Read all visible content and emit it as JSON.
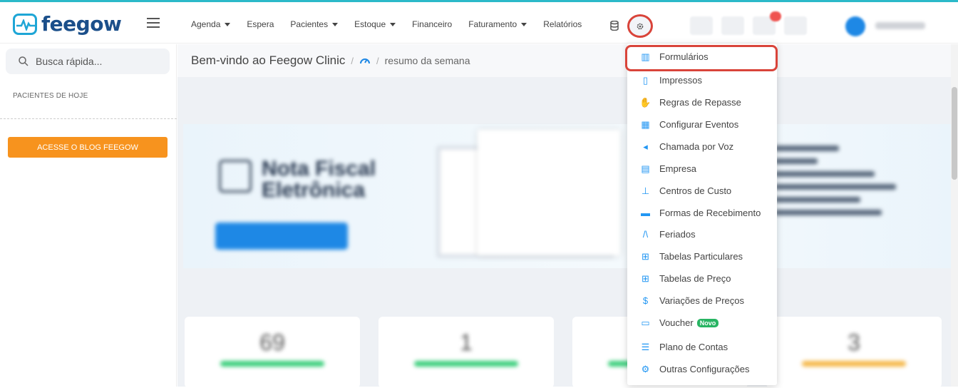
{
  "app": {
    "logo_text": "feegow"
  },
  "nav": {
    "items": [
      {
        "label": "Agenda",
        "dropdown": true
      },
      {
        "label": "Espera",
        "dropdown": false
      },
      {
        "label": "Pacientes",
        "dropdown": true
      },
      {
        "label": "Estoque",
        "dropdown": true
      },
      {
        "label": "Financeiro",
        "dropdown": false
      },
      {
        "label": "Faturamento",
        "dropdown": true
      },
      {
        "label": "Relatórios",
        "dropdown": false
      }
    ]
  },
  "sidebar": {
    "search_placeholder": "Busca rápida...",
    "patients_today": "PACIENTES DE HOJE",
    "blog_button": "ACESSE O BLOG FEEGOW"
  },
  "breadcrumb": {
    "title": "Bem-vindo ao Feegow Clinic",
    "sub": "resumo da semana"
  },
  "banner": {
    "title_line1": "Nota Fiscal",
    "title_line2": "Eletrônica"
  },
  "cards": [
    {
      "value": "69",
      "color": "#3ccf7c"
    },
    {
      "value": "1",
      "color": "#3ccf7c"
    },
    {
      "value": "",
      "color": "#3ccf7c"
    },
    {
      "value": "3",
      "color": "#f5b84a"
    }
  ],
  "settings_menu": {
    "items": [
      {
        "label": "Formulários",
        "icon": "chart-icon"
      },
      {
        "label": "Impressos",
        "icon": "file-icon"
      },
      {
        "label": "Regras de Repasse",
        "icon": "handshake-icon"
      },
      {
        "label": "Configurar Eventos",
        "icon": "calendar-icon"
      },
      {
        "label": "Chamada por Voz",
        "icon": "speaker-icon"
      },
      {
        "label": "Empresa",
        "icon": "building-icon"
      },
      {
        "label": "Centros de Custo",
        "icon": "sitemap-icon"
      },
      {
        "label": "Formas de Recebimento",
        "icon": "credit-card-icon"
      },
      {
        "label": "Feriados",
        "icon": "road-icon"
      },
      {
        "label": "Tabelas Particulares",
        "icon": "table-icon"
      },
      {
        "label": "Tabelas de Preço",
        "icon": "table-icon"
      },
      {
        "label": "Variações de Preços",
        "icon": "dollar-icon"
      },
      {
        "label": "Voucher",
        "icon": "ticket-icon",
        "badge": "Novo"
      },
      {
        "label": "Plano de Contas",
        "icon": "list-icon"
      },
      {
        "label": "Outras Configurações",
        "icon": "gears-icon"
      }
    ]
  }
}
